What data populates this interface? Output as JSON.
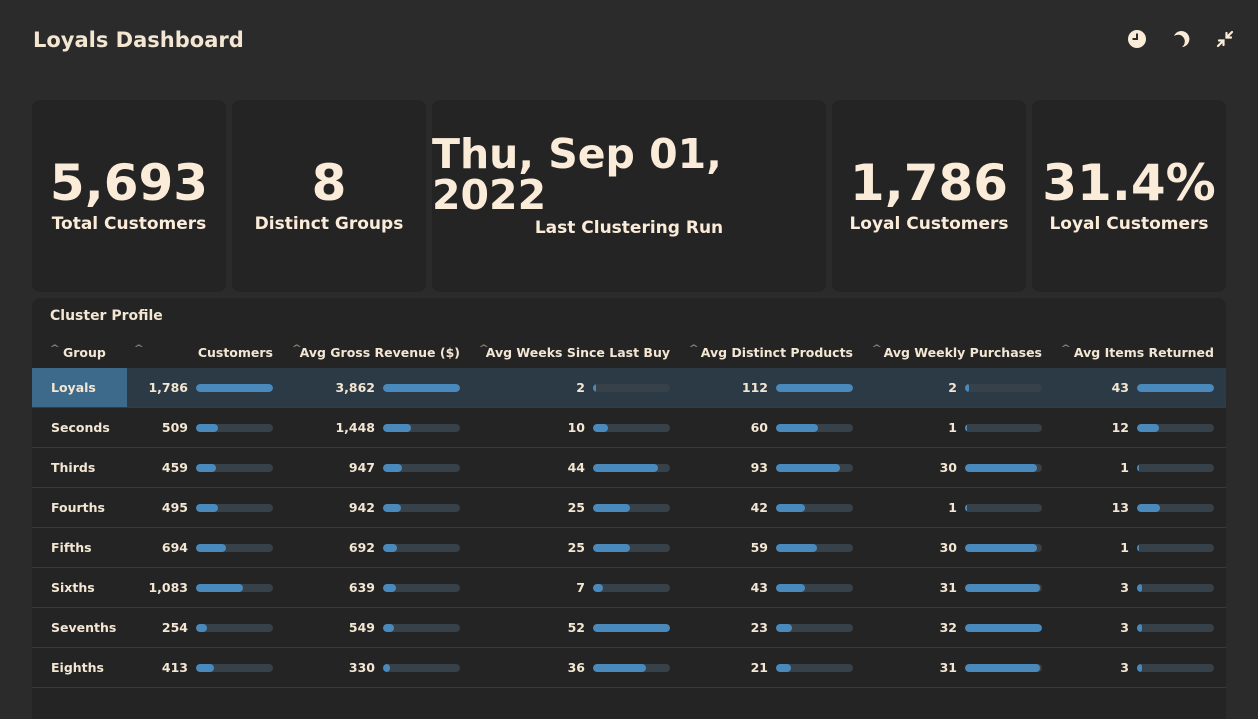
{
  "app": {
    "title": "Loyals Dashboard",
    "icons": [
      "clock-icon",
      "moon-icon",
      "collapse-icon"
    ]
  },
  "kpis": [
    {
      "value": "5,693",
      "label": "Total Customers"
    },
    {
      "value": "8",
      "label": "Distinct Groups"
    },
    {
      "value": "Thu, Sep 01, 2022",
      "label": "Last Clustering Run"
    },
    {
      "value": "1,786",
      "label": "Loyal Customers"
    },
    {
      "value": "31.4%",
      "label": "Loyal Customers"
    }
  ],
  "cluster_profile": {
    "title": "Cluster Profile",
    "columns": [
      "Group",
      "Customers",
      "Avg Gross Revenue ($)",
      "Avg Weeks Since Last Buy",
      "Avg Distinct Products",
      "Avg Weekly Purchases",
      "Avg Items Returned"
    ],
    "selected_row": 0,
    "rows": [
      {
        "group": "Loyals",
        "values": [
          "1,786",
          "3,862",
          "2",
          "112",
          "2",
          "43"
        ],
        "fill": [
          1.0,
          1.0,
          0.04,
          1.0,
          0.05,
          1.0
        ]
      },
      {
        "group": "Seconds",
        "values": [
          "509",
          "1,448",
          "10",
          "60",
          "1",
          "12"
        ],
        "fill": [
          0.28,
          0.37,
          0.19,
          0.54,
          0.03,
          0.28
        ]
      },
      {
        "group": "Thirds",
        "values": [
          "459",
          "947",
          "44",
          "93",
          "30",
          "1"
        ],
        "fill": [
          0.26,
          0.25,
          0.85,
          0.83,
          0.94,
          0.02
        ]
      },
      {
        "group": "Fourths",
        "values": [
          "495",
          "942",
          "25",
          "42",
          "1",
          "13"
        ],
        "fill": [
          0.28,
          0.24,
          0.48,
          0.38,
          0.03,
          0.3
        ]
      },
      {
        "group": "Fifths",
        "values": [
          "694",
          "692",
          "25",
          "59",
          "30",
          "1"
        ],
        "fill": [
          0.39,
          0.18,
          0.48,
          0.53,
          0.94,
          0.02
        ]
      },
      {
        "group": "Sixths",
        "values": [
          "1,083",
          "639",
          "7",
          "43",
          "31",
          "3"
        ],
        "fill": [
          0.61,
          0.17,
          0.13,
          0.38,
          0.97,
          0.07
        ]
      },
      {
        "group": "Sevenths",
        "values": [
          "254",
          "549",
          "52",
          "23",
          "32",
          "3"
        ],
        "fill": [
          0.14,
          0.14,
          1.0,
          0.21,
          1.0,
          0.07
        ]
      },
      {
        "group": "Eighths",
        "values": [
          "413",
          "330",
          "36",
          "21",
          "31",
          "3"
        ],
        "fill": [
          0.23,
          0.09,
          0.69,
          0.19,
          0.97,
          0.07
        ]
      }
    ]
  },
  "colors": {
    "background": "#2b2b2b",
    "card": "#242424",
    "bar": "#4a89bb",
    "bar_track": "#37414a",
    "selected": "#3d6a8b",
    "text": "#f3e6d3"
  }
}
